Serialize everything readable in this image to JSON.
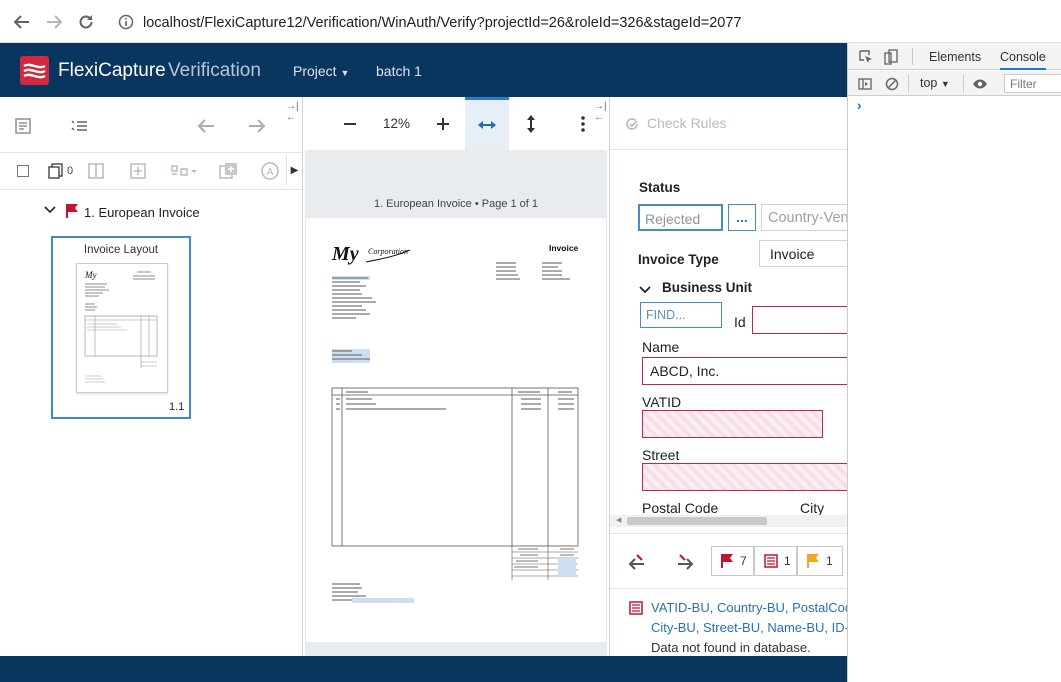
{
  "browser": {
    "url": "localhost/FlexiCapture12/Verification/WinAuth/Verify?projectId=26&roleId=326&stageId=2077"
  },
  "app": {
    "brand": "FlexiCapture",
    "module": "Verification",
    "menu": {
      "project": "Project",
      "batch": "batch 1"
    }
  },
  "left_panel": {
    "page_count": "0",
    "tree_item": "1. European Invoice",
    "thumb_title": "Invoice Layout",
    "thumb_number": "1.1"
  },
  "viewer": {
    "zoom": "12%",
    "page_caption": "1. European Invoice • Page 1 of 1"
  },
  "form": {
    "check_rules": "Check Rules",
    "status_label": "Status",
    "status_value": "Rejected",
    "ellipsis": "...",
    "country_vendor_placeholder": "Country-Vendo",
    "invoice_type_label": "Invoice Type",
    "invoice_type_value": "Invoice",
    "business_unit_label": "Business Unit",
    "find_placeholder": "FIND...",
    "id_label": "Id",
    "name_label": "Name",
    "name_value": "ABCD, Inc.",
    "vatid_label": "VATID",
    "street_label": "Street",
    "postal_code_label": "Postal Code",
    "city_label": "City"
  },
  "bottom": {
    "flag_counts": {
      "red": "7",
      "doc": "1",
      "orange": "1"
    },
    "error_fields_line1": [
      "VATID-BU,",
      "Country-BU,",
      "PostalCod"
    ],
    "error_fields_line2": [
      "City-BU,",
      "Street-BU,",
      "Name-BU,",
      "ID-"
    ],
    "error_message": "Data not found in database."
  },
  "devtools": {
    "tabs": {
      "elements": "Elements",
      "console": "Console"
    },
    "context": "top",
    "filter_placeholder": "Filter",
    "prompt": "›"
  },
  "colors": {
    "header": "#08365e",
    "brand_red": "#d3283f",
    "field_blue": "#4a89c8",
    "error_red": "#c0284a",
    "flag_red": "#c4122f",
    "flag_orange": "#f5a623"
  },
  "icons": [
    "back-arrow-icon",
    "forward-arrow-icon",
    "reload-icon",
    "info-icon",
    "logo-icon",
    "zoom-out-icon",
    "zoom-in-icon",
    "fit-width-icon",
    "fit-height-icon",
    "more-icon",
    "check-rules-icon",
    "flag-icon"
  ]
}
